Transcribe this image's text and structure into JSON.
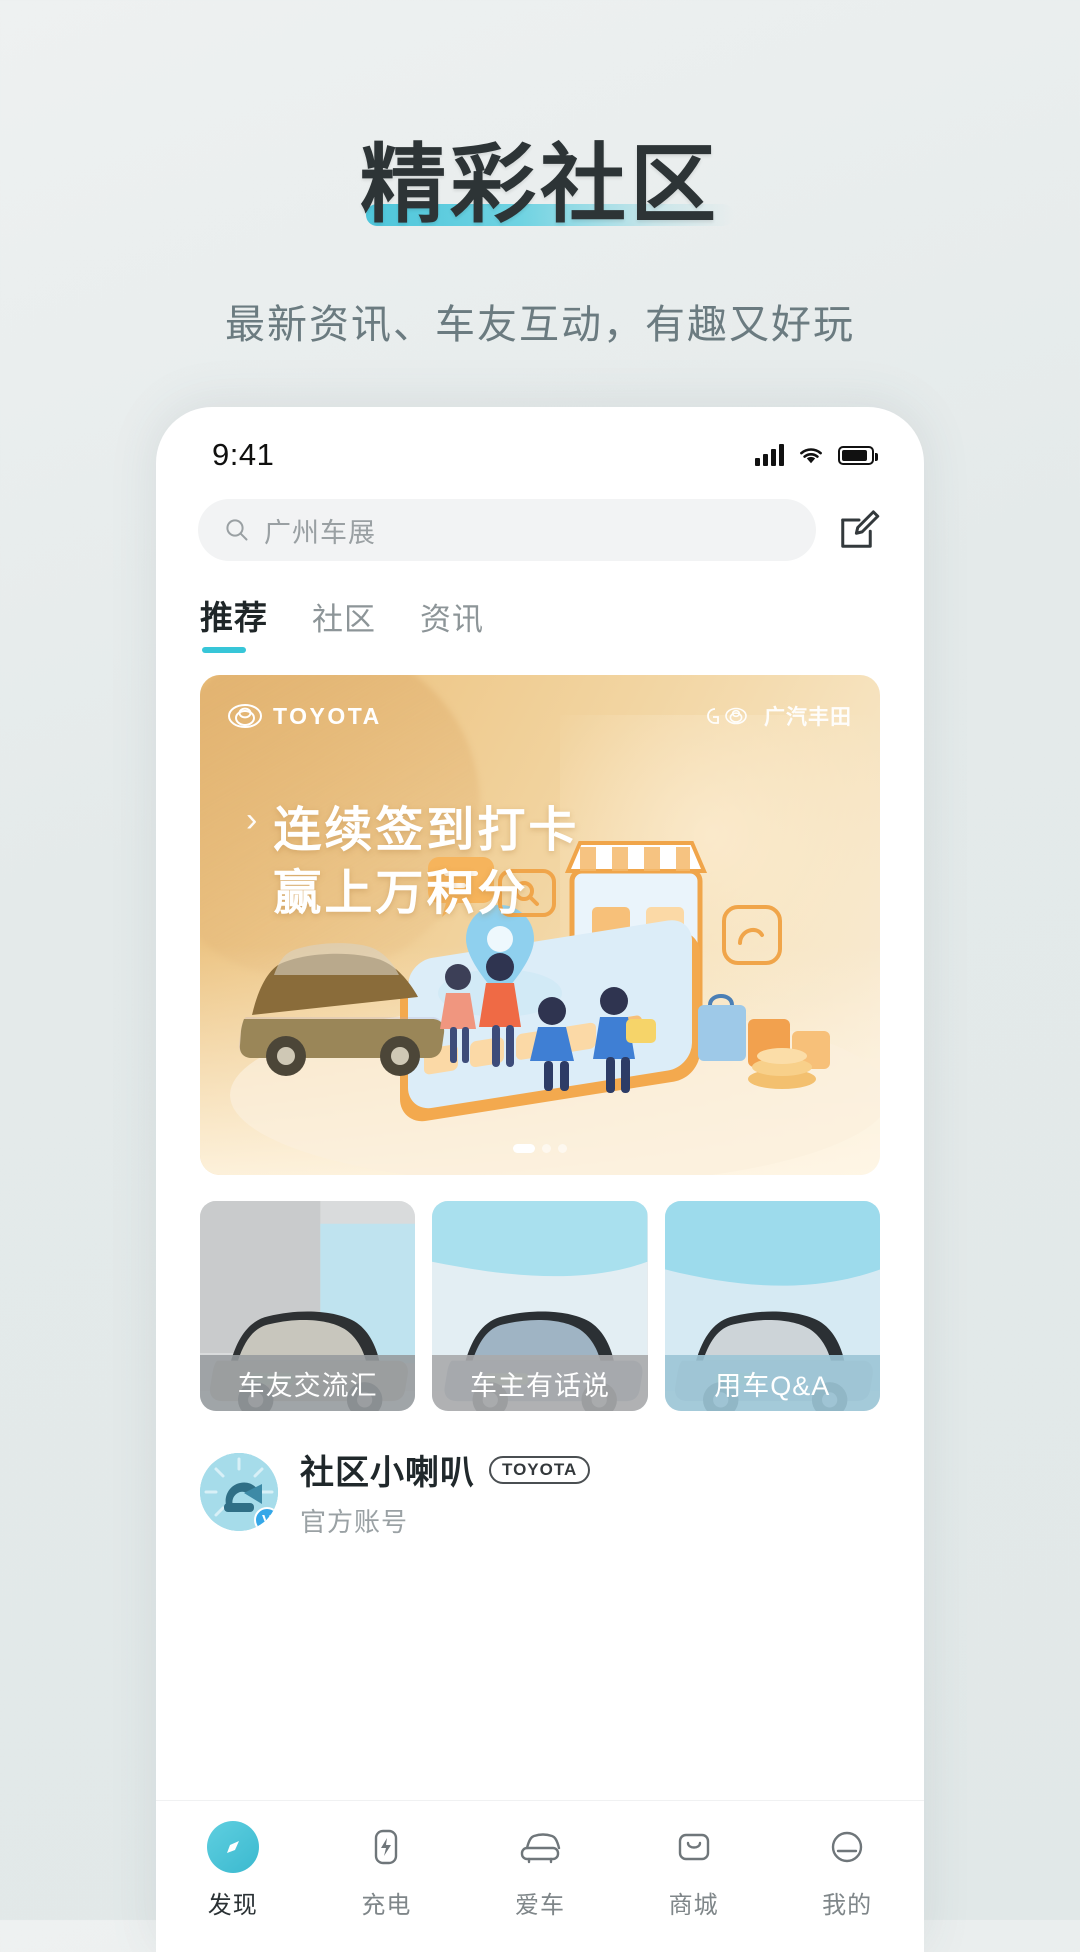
{
  "promo": {
    "title": "精彩社区",
    "subtitle": "最新资讯、车友互动，有趣又好玩"
  },
  "colors": {
    "accent": "#37c6d8",
    "underline": "#4ec6db",
    "page_bg": "#e6ecec",
    "banner_from": "#e8bc77",
    "banner_to": "#faeedb"
  },
  "phone": {
    "statusbar": {
      "time": "9:41",
      "signal_icon": "cellular-signal-icon",
      "wifi_icon": "wifi-icon",
      "battery_icon": "battery-icon"
    },
    "search": {
      "icon": "search-icon",
      "placeholder": "广州车展",
      "value": "",
      "compose_icon": "compose-edit-icon"
    },
    "tabs": [
      {
        "label": "推荐",
        "active": true
      },
      {
        "label": "社区",
        "active": false
      },
      {
        "label": "资讯",
        "active": false
      }
    ],
    "banner": {
      "brand_logo": "toyota-logo-icon",
      "brand_word": "TOYOTA",
      "partner_logo": "gac-toyota-logo-icon",
      "partner_word": "广汽丰田",
      "arrow": "›",
      "headline_line1": "连续签到打卡",
      "headline_line2": "赢上万积分",
      "dots_total": 3,
      "dots_active_index": 0
    },
    "cards": [
      {
        "label": "车友交流汇"
      },
      {
        "label": "车主有话说"
      },
      {
        "label": "用车Q&A"
      }
    ],
    "account": {
      "avatar_icon": "community-megaphone-avatar",
      "verified_icon": "verified-badge-icon",
      "verified_letter": "V",
      "name": "社区小喇叭",
      "brand_tag": "TOYOTA",
      "subtitle": "官方账号"
    },
    "tabbar": [
      {
        "label": "发现",
        "icon": "compass-discover-icon",
        "active": true
      },
      {
        "label": "充电",
        "icon": "charging-bolt-icon",
        "active": false
      },
      {
        "label": "爱车",
        "icon": "car-icon",
        "active": false
      },
      {
        "label": "商城",
        "icon": "shop-bag-icon",
        "active": false
      },
      {
        "label": "我的",
        "icon": "profile-icon",
        "active": false
      }
    ]
  }
}
